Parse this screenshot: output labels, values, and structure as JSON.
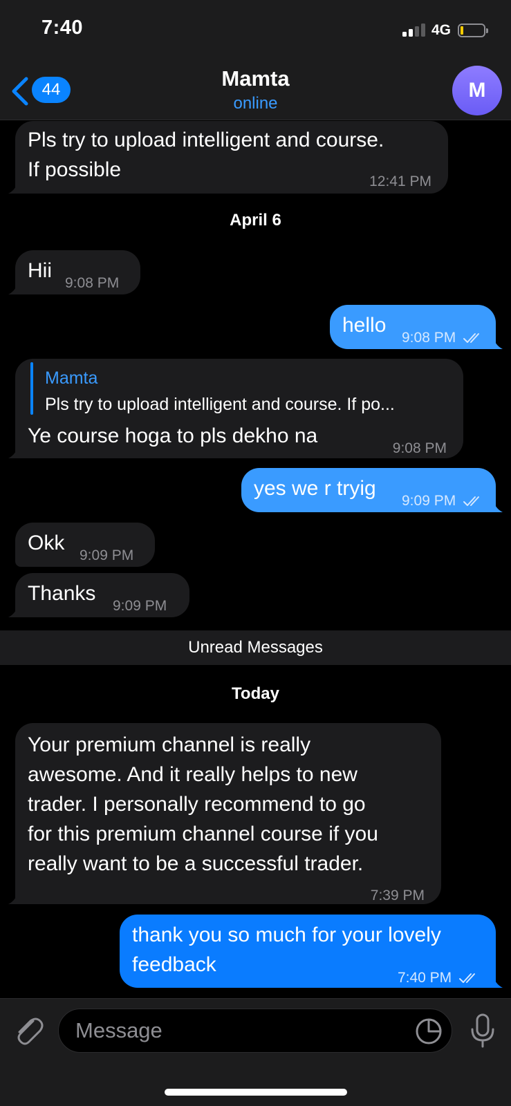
{
  "status_bar": {
    "time": "7:40",
    "network": "4G",
    "battery_level": 0.1,
    "signal_bars": 2
  },
  "header": {
    "back_badge": "44",
    "contact_name": "Mamta",
    "contact_status": "online",
    "avatar_initial": "M"
  },
  "messages": [
    {
      "dir": "in",
      "text_line1": "Pls try to upload intelligent and course.",
      "text_line2": "If possible",
      "time": "12:41 PM"
    },
    {
      "dir": "in",
      "text": "Hii",
      "time": "9:08 PM"
    },
    {
      "dir": "out",
      "text": "hello",
      "time": "9:08 PM",
      "read": true
    },
    {
      "dir": "in",
      "reply_name": "Mamta",
      "reply_text": "Pls try to upload intelligent and course. If po...",
      "text": "Ye course hoga to pls dekho na",
      "time": "9:08 PM"
    },
    {
      "dir": "out",
      "text": "yes we r tryig",
      "time": "9:09 PM",
      "read": true
    },
    {
      "dir": "in",
      "text": "Okk",
      "time": "9:09 PM"
    },
    {
      "dir": "in",
      "text": "Thanks",
      "time": "9:09 PM"
    },
    {
      "dir": "in",
      "lines": [
        "Your premium channel is really",
        "awesome. And it really helps to new",
        "trader. I personally recommend to go",
        "for this premium channel course if you",
        "really want to be a successful trader."
      ],
      "time": "7:39 PM"
    },
    {
      "dir": "out",
      "lines": [
        "thank you so much for your lovely",
        "feedback"
      ],
      "time": "7:40 PM",
      "read": true
    }
  ],
  "separators": {
    "date1": "April 6",
    "unread": "Unread Messages",
    "date2": "Today"
  },
  "input": {
    "placeholder": "Message"
  },
  "icons": [
    "back-chevron-icon",
    "paperclip-icon",
    "sticker-icon",
    "microphone-icon",
    "double-check-icon"
  ],
  "colors": {
    "accent": "#0a84ff",
    "outgoing": "#3a9bff",
    "incoming": "#1c1c1e",
    "background": "#000000"
  }
}
